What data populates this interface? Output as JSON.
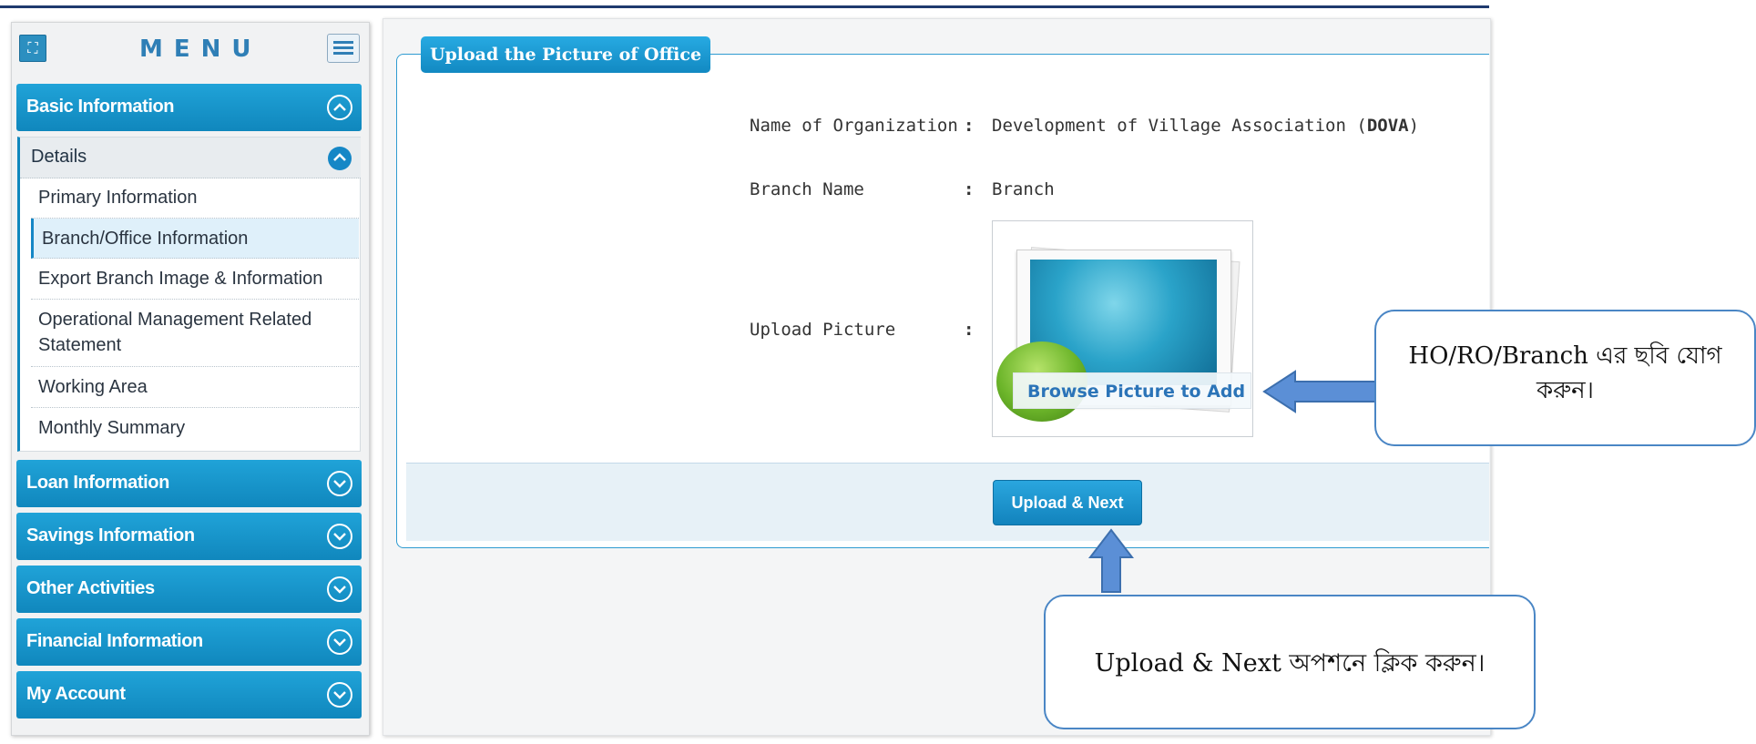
{
  "sidebar": {
    "title": "MENU",
    "sections": {
      "basic": "Basic Information",
      "loan": "Loan Information",
      "savings": "Savings Information",
      "other": "Other Activities",
      "financial": "Financial Information",
      "account": "My Account"
    },
    "details": {
      "label": "Details",
      "items": [
        "Primary Information",
        "Branch/Office Information",
        "Export Branch Image & Information",
        "Operational Management Related Statement",
        "Working Area",
        "Monthly Summary"
      ]
    }
  },
  "form": {
    "legend": "Upload the Picture of Office",
    "org_label": "Name of Organization",
    "org_value": "Development of Village Association (",
    "org_value_bold": "DOVA",
    "org_value_end": ")",
    "branch_label": "Branch Name",
    "branch_value": "Branch",
    "picture_label": "Upload Picture",
    "colon": ":",
    "browse_label": "Browse Picture to Add",
    "submit_label": "Upload & Next"
  },
  "callouts": {
    "picture_note": "HO/RO/Branch এর ছবি যোগ করুন।",
    "upload_note": "Upload & Next অপশনে ক্লিক করুন।"
  },
  "colors": {
    "accent": "#1587c6",
    "callout_border": "#4a86c5"
  }
}
